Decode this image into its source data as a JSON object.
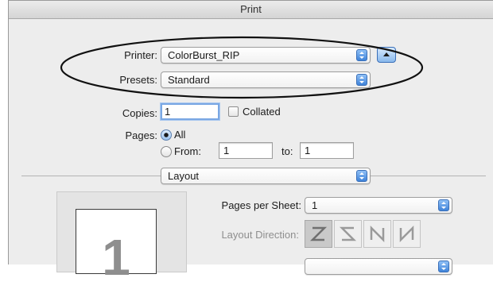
{
  "window": {
    "title": "Print"
  },
  "printer": {
    "label": "Printer:",
    "value": "ColorBurst_RIP"
  },
  "presets": {
    "label": "Presets:",
    "value": "Standard"
  },
  "copies": {
    "label": "Copies:",
    "value": "1",
    "collated_label": "Collated"
  },
  "pages": {
    "label": "Pages:",
    "all_label": "All",
    "from_label": "From:",
    "from_value": "1",
    "to_label": "to:",
    "to_value": "1",
    "selected": "All"
  },
  "section": {
    "value": "Layout"
  },
  "layout": {
    "pages_per_sheet_label": "Pages per Sheet:",
    "pages_per_sheet_value": "1",
    "layout_direction_label": "Layout Direction:"
  },
  "preview": {
    "page_number": "1"
  },
  "colors": {
    "accent": "#3f83d9",
    "highlight_ellipse": "#111111"
  }
}
